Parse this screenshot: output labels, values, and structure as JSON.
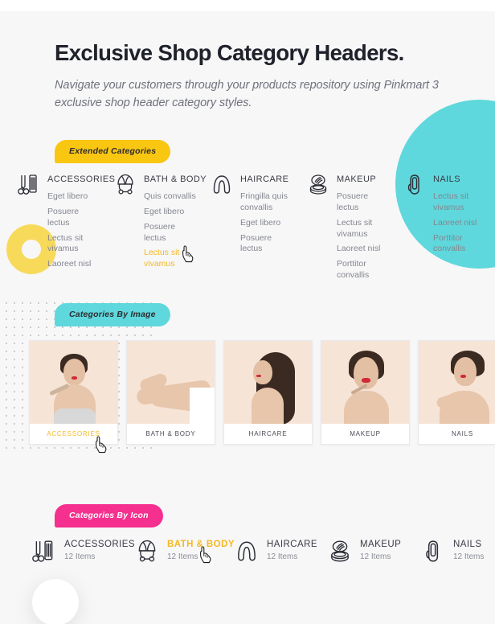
{
  "header": {
    "title": "Exclusive Shop Category Headers.",
    "subtitle": "Navigate your customers through your products repository using Pinkmart 3 exclusive shop header category styles."
  },
  "colors": {
    "accent_yellow": "#f9c612",
    "accent_teal": "#5fd8dd",
    "accent_pink": "#f5308e",
    "active_text": "#f5b922",
    "background": "#f7f7f8",
    "heading": "#20222b",
    "body_text": "#84878f"
  },
  "sections": {
    "extended": {
      "badge": "Extended Categories",
      "columns": [
        {
          "title": "ACCESSORIES",
          "icon": "scissors-comb-icon",
          "items": [
            "Eget libero",
            "Posuere lectus",
            "Lectus sit vivamus",
            "Laoreet nisl"
          ],
          "active_index": -1
        },
        {
          "title": "BATH & BODY",
          "icon": "shower-cap-icon",
          "items": [
            "Quis convallis",
            "Eget libero",
            "Posuere lectus",
            "Lectus sit vivamus"
          ],
          "active_index": 3
        },
        {
          "title": "HAIRCARE",
          "icon": "wig-icon",
          "items": [
            "Fringilla quis convallis",
            "Eget libero",
            "Posuere lectus"
          ],
          "active_index": -1
        },
        {
          "title": "MAKEUP",
          "icon": "powder-compact-icon",
          "items": [
            "Posuere lectus",
            "Lectus sit vivamus",
            "Laoreet nisl",
            "Porttitor convallis"
          ],
          "active_index": -1
        },
        {
          "title": "NAILS",
          "icon": "fingernail-icon",
          "items": [
            "Lectus sit vivamus",
            "Laoreet nisl",
            "Porttitor convallis"
          ],
          "active_index": -1
        }
      ]
    },
    "by_image": {
      "badge": "Categories By Image",
      "cards": [
        {
          "label": "ACCESSORIES",
          "active": true
        },
        {
          "label": "BATH & BODY",
          "active": false
        },
        {
          "label": "HAIRCARE",
          "active": false
        },
        {
          "label": "MAKEUP",
          "active": false
        },
        {
          "label": "NAILS",
          "active": false
        }
      ]
    },
    "by_icon": {
      "badge": "Categories By Icon",
      "items": [
        {
          "title": "ACCESSORIES",
          "count": "12 Items",
          "icon": "scissors-comb-icon",
          "active": false
        },
        {
          "title": "BATH & BODY",
          "count": "12 Items",
          "icon": "shower-cap-icon",
          "active": true
        },
        {
          "title": "HAIRCARE",
          "count": "12 Items",
          "icon": "wig-icon",
          "active": false
        },
        {
          "title": "MAKEUP",
          "count": "12 Items",
          "icon": "powder-compact-icon",
          "active": false
        },
        {
          "title": "NAILS",
          "count": "12 Items",
          "icon": "fingernail-icon",
          "active": false
        }
      ]
    }
  },
  "decorations": [
    {
      "name": "teal-circle",
      "color": "#5fd8dd"
    },
    {
      "name": "yellow-ring",
      "color": "#f8da5b"
    },
    {
      "name": "dot-grid",
      "color": "#c9c9cf"
    },
    {
      "name": "white-circle",
      "color": "#ffffff"
    }
  ],
  "cursors": [
    {
      "name": "cursor-extended-bath-body"
    },
    {
      "name": "cursor-image-accessories"
    },
    {
      "name": "cursor-icon-bath-body"
    }
  ]
}
